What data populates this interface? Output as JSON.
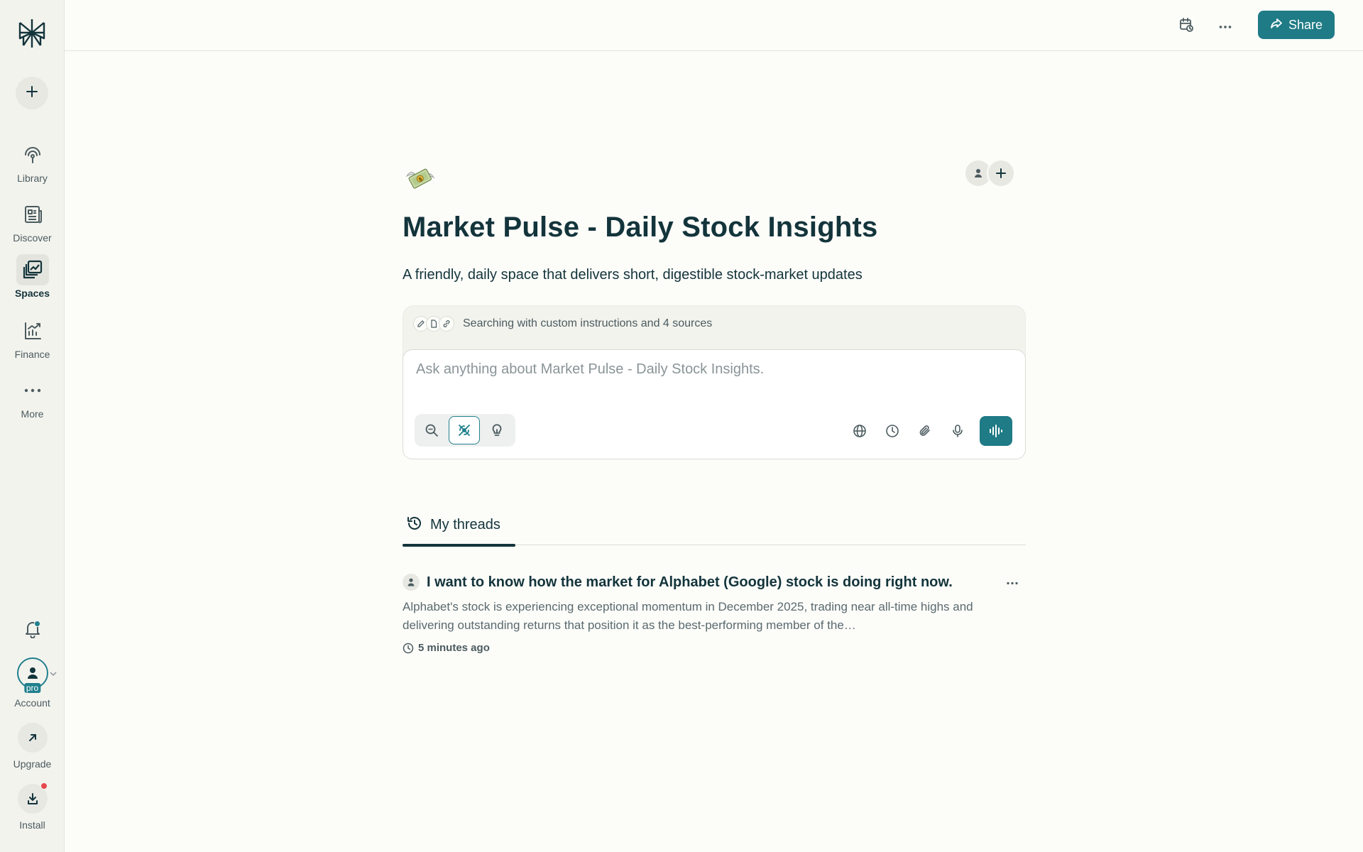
{
  "sidebar": {
    "items": [
      {
        "label": "Library",
        "icon": "library-icon"
      },
      {
        "label": "Discover",
        "icon": "discover-icon"
      },
      {
        "label": "Spaces",
        "icon": "spaces-icon",
        "active": true
      },
      {
        "label": "Finance",
        "icon": "finance-icon"
      },
      {
        "label": "More",
        "icon": "more-dots-icon"
      }
    ],
    "account_label": "Account",
    "pro_badge": "pro",
    "upgrade_label": "Upgrade",
    "install_label": "Install"
  },
  "topbar": {
    "share_label": "Share"
  },
  "space": {
    "emoji": "money-with-wings-icon",
    "title": "Market Pulse - Daily Stock Insights",
    "description": "A friendly, daily space that delivers short, digestible stock-market updates"
  },
  "search": {
    "instructions_text": "Searching with custom instructions and 4 sources",
    "placeholder": "Ask anything about Market Pulse - Daily Stock Insights."
  },
  "tabs": [
    {
      "label": "My threads",
      "active": true
    }
  ],
  "threads": [
    {
      "title": "I want to know how the market for Alphabet (Google) stock is doing right now.",
      "snippet": "Alphabet's stock is experiencing exceptional momentum in December 2025, trading near all-time highs and delivering outstanding returns that position it as the best-performing member of the…",
      "time": "5 minutes ago"
    }
  ],
  "colors": {
    "accent": "#1f7b86",
    "text": "#13343b",
    "background": "#fcfcf9",
    "sidebar": "#f3f3ee"
  }
}
